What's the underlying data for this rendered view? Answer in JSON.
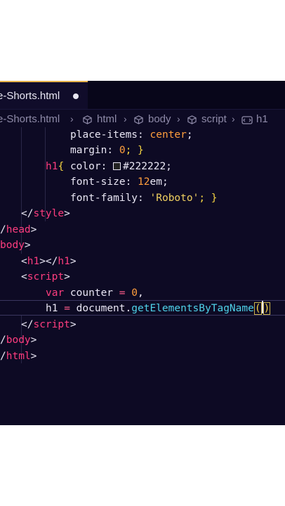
{
  "tab": {
    "title": "e-Shorts.html"
  },
  "breadcrumb": {
    "file": "e-Shorts.html",
    "items": [
      "html",
      "body",
      "script",
      "h1"
    ]
  },
  "code": {
    "l1": [
      "place-items",
      ": ",
      "center",
      ";"
    ],
    "l2": [
      "margin",
      ": ",
      "0",
      "; }"
    ],
    "l3": [
      "h1",
      "{ ",
      "color",
      ": ",
      "#222222",
      ";"
    ],
    "l4": [
      "font-size",
      ": ",
      "12",
      "em",
      ";"
    ],
    "l5": [
      "font-family",
      ": ",
      "'Roboto'",
      "; }"
    ],
    "l6": [
      "</",
      "style",
      ">"
    ],
    "l7": [
      "/",
      "head",
      ">"
    ],
    "l8": [
      "body",
      ">"
    ],
    "l9": [
      "<",
      "h1",
      "></",
      "h1",
      ">"
    ],
    "l10": [
      "<",
      "script",
      ">"
    ],
    "l11": [
      "var",
      " counter ",
      "=",
      " ",
      "0",
      ","
    ],
    "l12": [
      "h1 ",
      "=",
      " document.",
      "getElementsByTagName",
      "(",
      ")"
    ],
    "l13": [
      "</",
      "script",
      ">"
    ],
    "l14": [
      "/",
      "body",
      ">"
    ],
    "l15": [
      "/",
      "html",
      ">"
    ]
  },
  "colors": {
    "background": "#0d0a24",
    "tag": "#ff3d7f",
    "number": "#ff9e3d",
    "function": "#4fd1e8",
    "string": "#f0d060"
  }
}
